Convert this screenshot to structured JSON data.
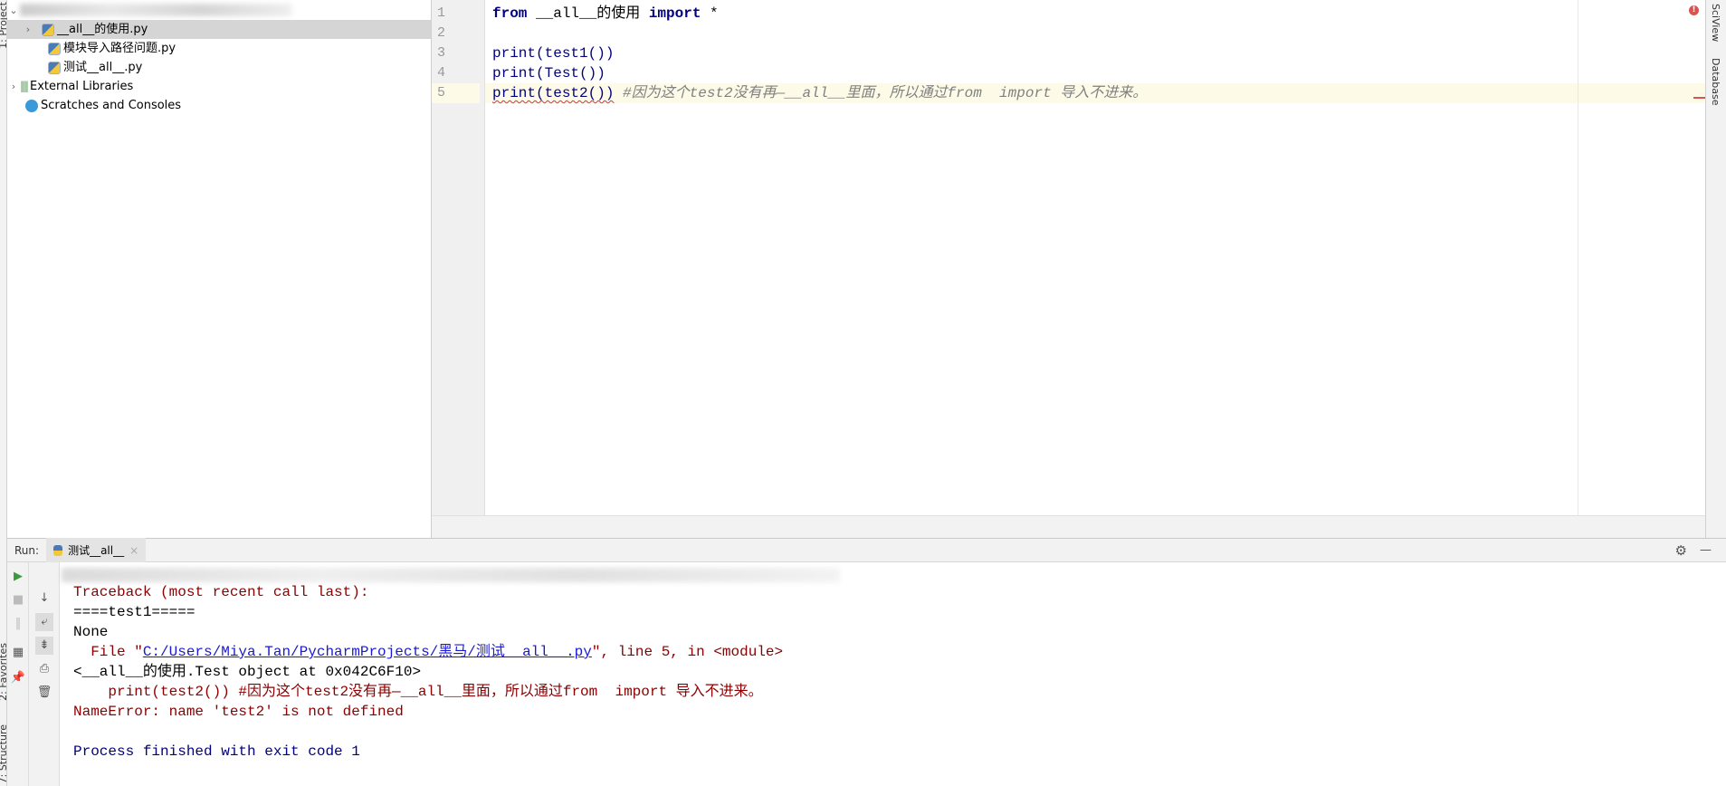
{
  "left_strip": {
    "labels": [
      "1: Project",
      "2: Favorites",
      "7: Structure"
    ]
  },
  "project_tree": {
    "items": [
      {
        "label": "__all__的使用.py",
        "selected": true,
        "expandable": true
      },
      {
        "label": "模块导入路径问题.py"
      },
      {
        "label": "测试__all__.py"
      },
      {
        "label": "External Libraries",
        "expandable": true
      },
      {
        "label": "Scratches and Consoles"
      }
    ]
  },
  "editor": {
    "line_numbers": [
      "1",
      "2",
      "3",
      "4",
      "5"
    ],
    "lines": [
      {
        "kw1": "from",
        "mid": " __all__的使用 ",
        "kw2": "import",
        "tail": " *"
      },
      {
        "text": ""
      },
      {
        "text": "print(test1())"
      },
      {
        "text": "print(Test())"
      },
      {
        "code": "print(test2())",
        "comment": " #因为这个test2没有再—__all__里面，所以通过from  import 导入不进来。"
      }
    ],
    "current_line": 5
  },
  "right_strip": {
    "labels": [
      "SciView",
      "Database"
    ]
  },
  "run": {
    "label": "Run:",
    "tab_label": "测试__all__",
    "output": [
      {
        "text": "Traceback (most recent call last):",
        "kind": "err"
      },
      {
        "text": "====test1=====",
        "kind": "std"
      },
      {
        "text": "None",
        "kind": "std"
      },
      {
        "prefix": "  File \"",
        "link": "C:/Users/Miya.Tan/PycharmProjects/黑马/测试__all__.py",
        "suffix": "\", line 5, in <module>",
        "kind": "err"
      },
      {
        "text": "<__all__的使用.Test object at 0x042C6F10>",
        "kind": "std"
      },
      {
        "text": "    print(test2()) #因为这个test2没有再—__all__里面，所以通过from  import 导入不进来。",
        "kind": "err"
      },
      {
        "text": "NameError: name 'test2' is not defined",
        "kind": "err"
      },
      {
        "text": "",
        "kind": "std"
      },
      {
        "text": "Process finished with exit code 1",
        "kind": "sys"
      }
    ]
  },
  "colors": {
    "error": "#8b0000",
    "keyword": "#000080",
    "comment": "#808080",
    "link": "#1a1ad0",
    "current_line": "#fdfbe8"
  }
}
